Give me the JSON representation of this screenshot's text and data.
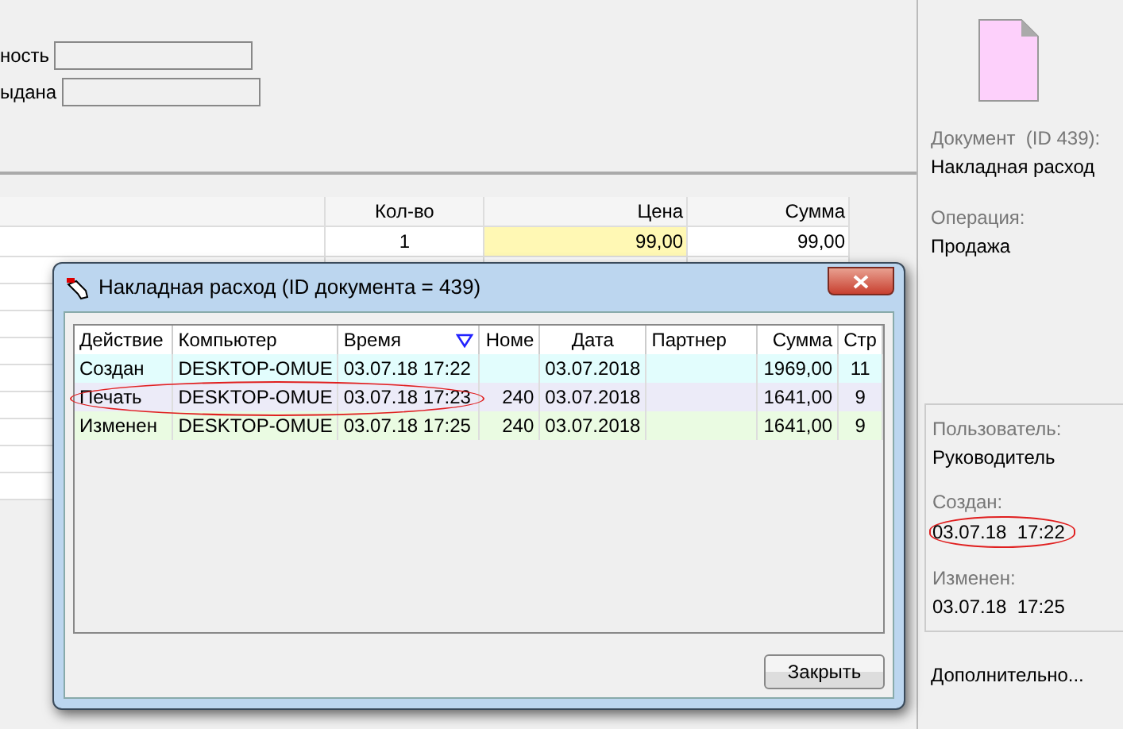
{
  "form": {
    "fields": [
      {
        "label": "ность"
      },
      {
        "label": "ыдана"
      }
    ]
  },
  "items_table": {
    "columns": [
      "Кол-во",
      "Цена",
      "Сумма"
    ],
    "rows": [
      [
        "1",
        "99,00",
        "99,00"
      ]
    ]
  },
  "side_panel": {
    "document_label": "Документ  (ID 439):",
    "document_value": "Накладная расход",
    "operation_label": "Операция:",
    "operation_value": "Продажа",
    "info": [
      {
        "label": "Пользователь:",
        "value": "Руководитель",
        "circled": false
      },
      {
        "label": "Создан:",
        "value": "03.07.18  17:22",
        "circled": true
      },
      {
        "label": "Изменен:",
        "value": "03.07.18  17:25",
        "circled": false
      }
    ],
    "more_link": "Дополнительно..."
  },
  "dialog": {
    "title": "Накладная расход (ID документа = 439)",
    "columns": [
      {
        "label": "Действие",
        "sorted": false
      },
      {
        "label": "Компьютер",
        "sorted": false
      },
      {
        "label": "Время",
        "sorted": true
      },
      {
        "label": "Номе",
        "sorted": false
      },
      {
        "label": "Дата",
        "sorted": false
      },
      {
        "label": "Партнер",
        "sorted": false
      },
      {
        "label": "Сумма",
        "sorted": false
      },
      {
        "label": "Стр",
        "sorted": false
      }
    ],
    "rows": [
      {
        "cells": [
          "Создан",
          "DESKTOP-OMUE",
          "03.07.18 17:22",
          "",
          "03.07.2018",
          "",
          "1969,00",
          "11"
        ],
        "color": "#e2fdfd",
        "circled": false
      },
      {
        "cells": [
          "Печать",
          "DESKTOP-OMUE",
          "03.07.18 17:23",
          "240",
          "03.07.2018",
          "",
          "1641,00",
          "9"
        ],
        "color": "#ecebf8",
        "circled": true
      },
      {
        "cells": [
          "Изменен",
          "DESKTOP-OMUE",
          "03.07.18 17:25",
          "240",
          "03.07.2018",
          "",
          "1641,00",
          "9"
        ],
        "color": "#eafbe2",
        "circled": false
      }
    ],
    "close_button": "Закрыть"
  }
}
